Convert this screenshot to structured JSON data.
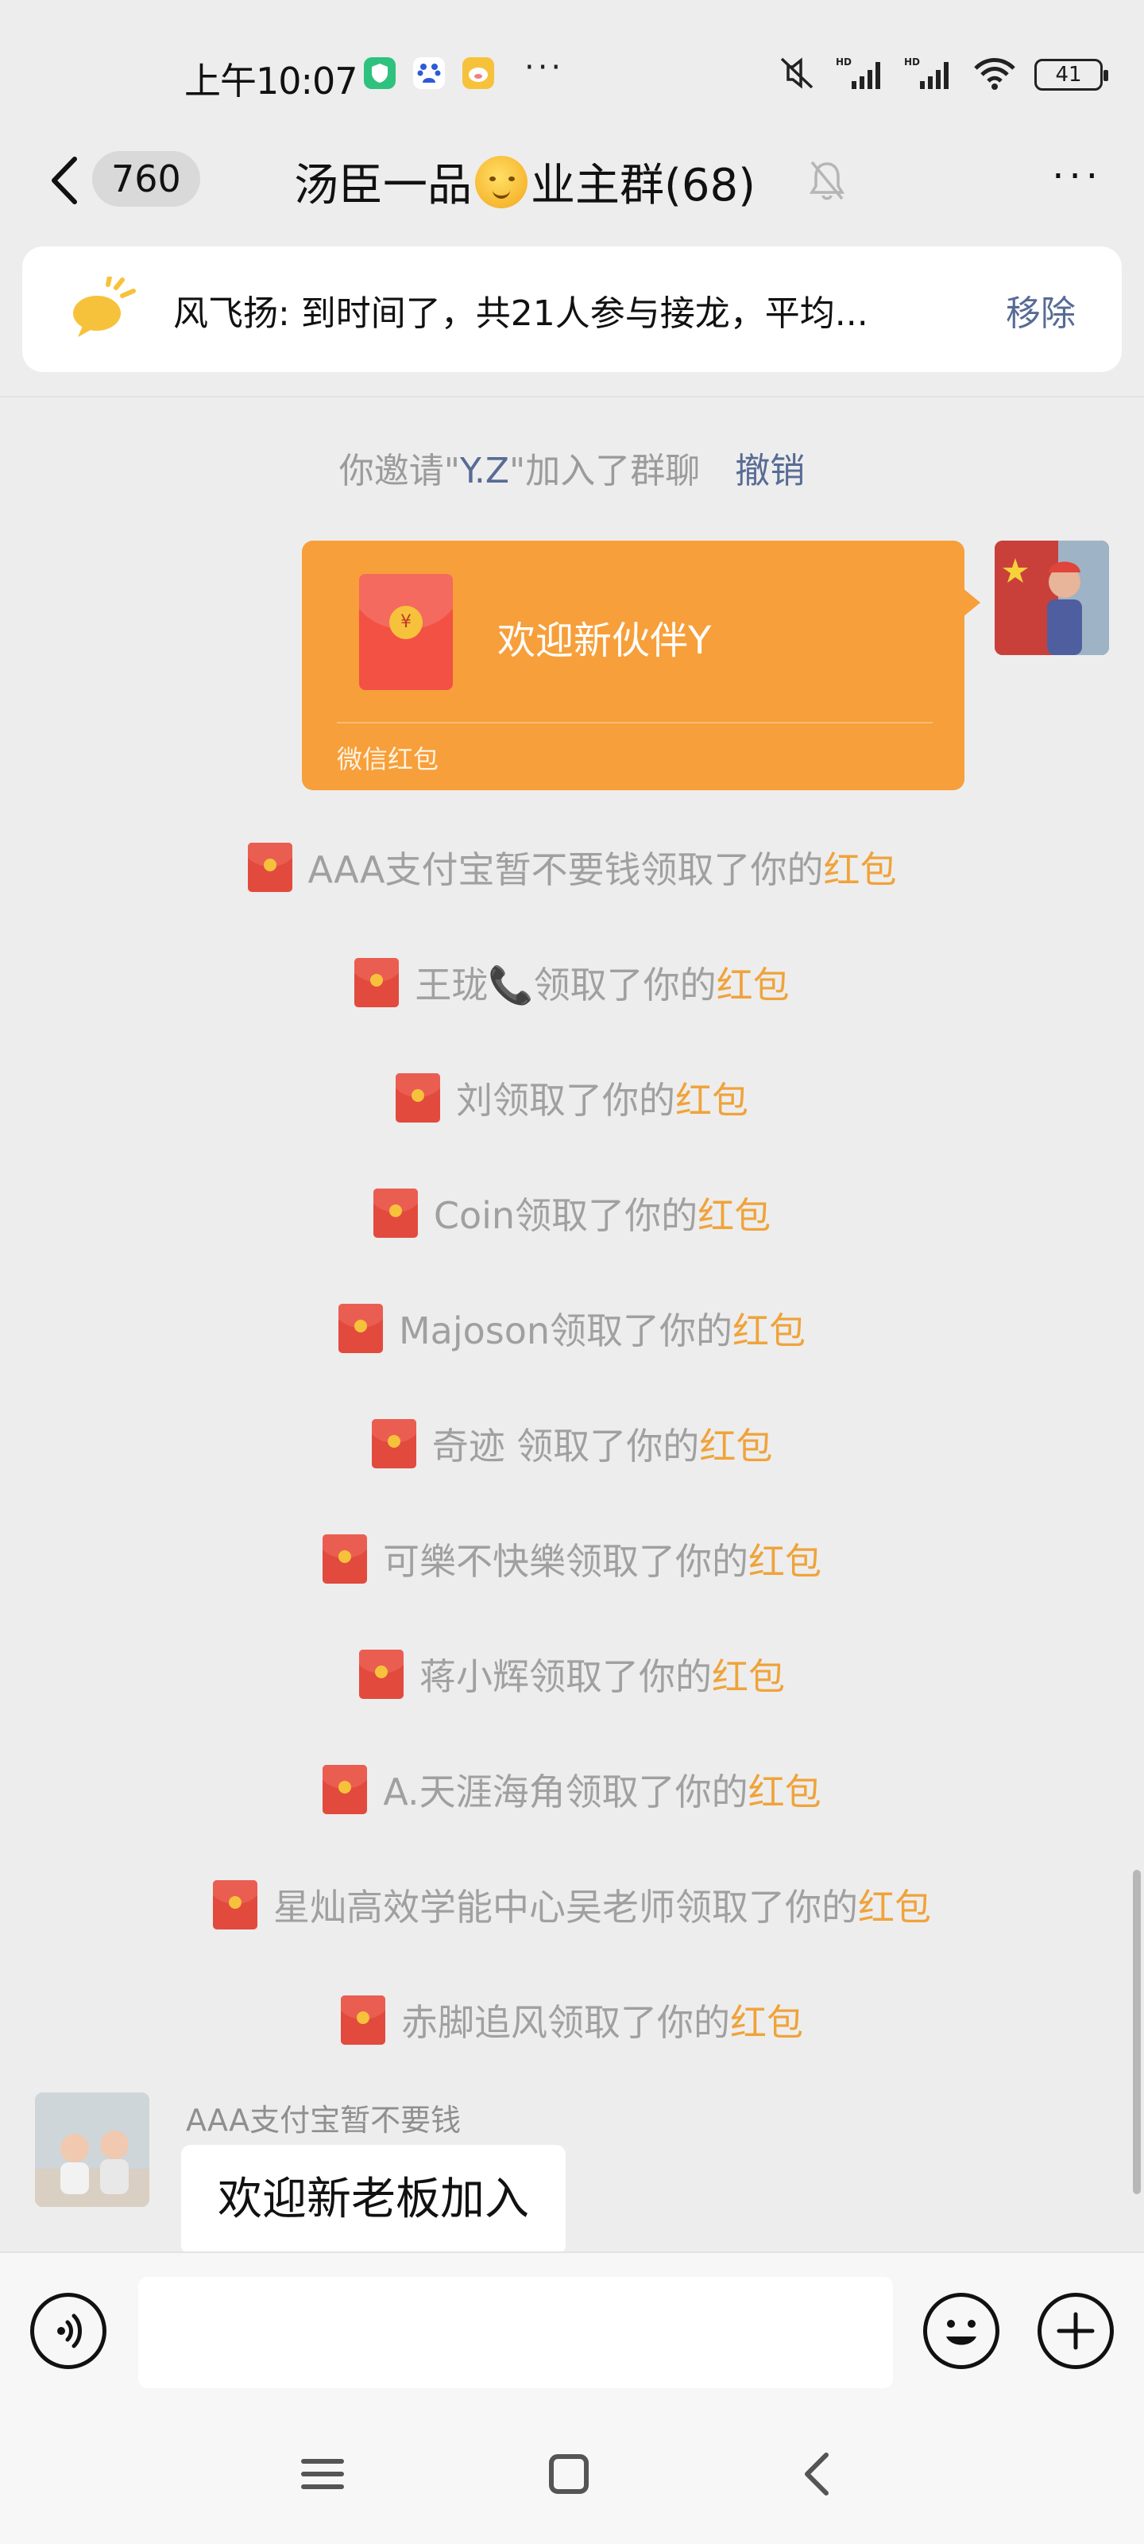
{
  "status_bar": {
    "time": "上午10:07",
    "app_icons": [
      "shield-app-icon",
      "baidu-paw-icon",
      "pig-app-icon"
    ],
    "more": "···",
    "battery": "41",
    "network": [
      "mute-icon",
      "hd-signal-icon",
      "hd-signal-icon",
      "wifi-icon",
      "battery-icon"
    ]
  },
  "header": {
    "unread_count": "760",
    "title_part1": "汤臣一品",
    "title_part2": "业主群(68)",
    "more": "···"
  },
  "pinned": {
    "text": "风飞扬: 到时间了，共21人参与接龙，平均...",
    "remove_label": "移除"
  },
  "system_notice": {
    "prefix": "你邀请\"",
    "name": "Y.Z",
    "suffix": "\"加入了群聊",
    "revoke_label": "撤销"
  },
  "red_packet": {
    "coin": "¥",
    "title": "欢迎新伙伴Y",
    "footer": "微信红包"
  },
  "claims": [
    {
      "text": "AAA支付宝暂不要钱领取了你的",
      "link": "红包"
    },
    {
      "text": "王珑📞领取了你的",
      "link": "红包"
    },
    {
      "text": "刘领取了你的",
      "link": "红包"
    },
    {
      "text": "Coin领取了你的",
      "link": "红包"
    },
    {
      "text": "Majoson领取了你的",
      "link": "红包"
    },
    {
      "text": "奇迹 领取了你的",
      "link": "红包"
    },
    {
      "text": "可樂不快樂领取了你的",
      "link": "红包"
    },
    {
      "text": "蒋小辉领取了你的",
      "link": "红包"
    },
    {
      "text": "A.天涯海角领取了你的",
      "link": "红包"
    },
    {
      "text": "星灿高效学能中心吴老师领取了你的",
      "link": "红包"
    },
    {
      "text": "赤脚追风领取了你的",
      "link": "红包"
    }
  ],
  "incoming": {
    "sender": "AAA支付宝暂不要钱",
    "message": "欢迎新老板加入"
  },
  "input": {
    "value": "",
    "placeholder": ""
  },
  "colors": {
    "background": "#ededed",
    "red_packet": "#f79f3a",
    "link_blue": "#576b95",
    "claim_orange": "#f0a33a"
  }
}
